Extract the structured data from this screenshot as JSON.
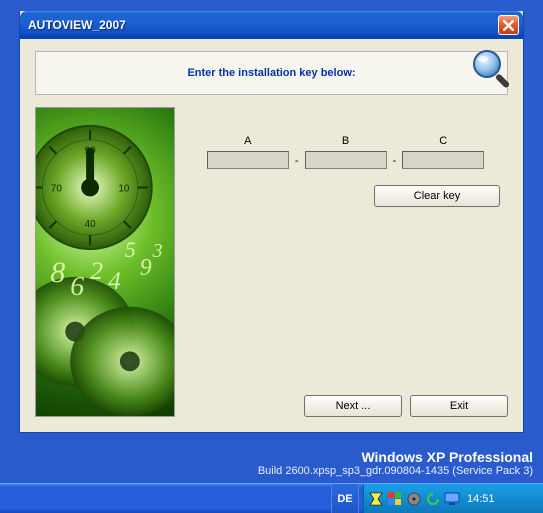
{
  "window": {
    "title": "AUTOVIEW_2007",
    "prompt": "Enter the installation key below:",
    "key_labels": {
      "a": "A",
      "b": "B",
      "c": "C"
    },
    "key_values": {
      "a": "",
      "b": "",
      "c": ""
    },
    "separator": "-",
    "buttons": {
      "clear": "Clear key",
      "next": "Next ...",
      "exit": "Exit"
    }
  },
  "desktop": {
    "branding_line1": "Windows XP Professional",
    "branding_line2": "Build 2600.xpsp_sp3_gdr.090804-1435 (Service Pack 3)"
  },
  "taskbar": {
    "language": "DE",
    "clock": "14:51"
  }
}
